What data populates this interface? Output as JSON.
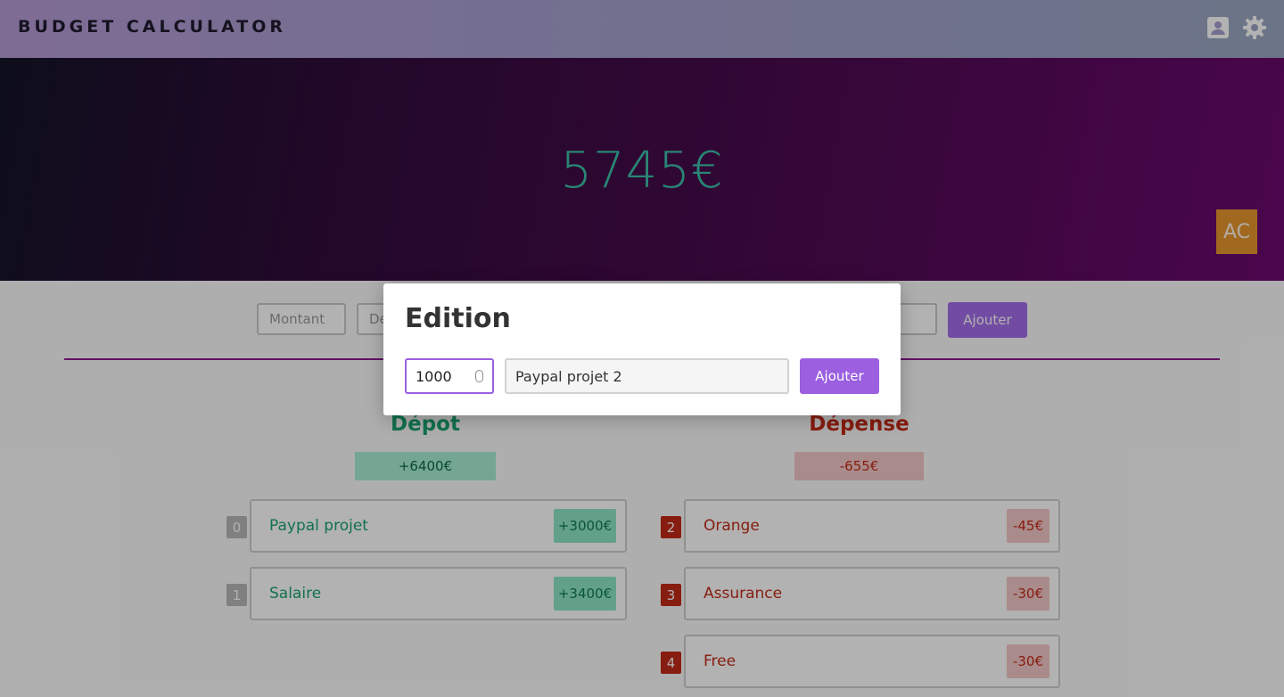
{
  "navbar": {
    "brand": "BUDGET CALCULATOR",
    "icons": [
      "user-card-icon",
      "gear-icon"
    ]
  },
  "hero": {
    "balance": "5745€",
    "avatar_initials": "AC"
  },
  "form": {
    "amount_placeholder": "Montant",
    "description_placeholder_visible": "De",
    "add_label": "Ajouter"
  },
  "deposits": {
    "title": "Dépot",
    "total": "+6400€",
    "items": [
      {
        "index": "0",
        "label": "Paypal projet",
        "amount": "+3000€"
      },
      {
        "index": "1",
        "label": "Salaire",
        "amount": "+3400€"
      }
    ]
  },
  "expenses": {
    "title": "Dépense",
    "total": "-655€",
    "items": [
      {
        "index": "2",
        "label": "Orange",
        "amount": "-45€"
      },
      {
        "index": "3",
        "label": "Assurance",
        "amount": "-30€"
      },
      {
        "index": "4",
        "label": "Free",
        "amount": "-30€"
      }
    ]
  },
  "modal": {
    "title": "Edition",
    "amount_value": "1000",
    "description_value": "Paypal projet 2",
    "add_label": "Ajouter"
  },
  "colors": {
    "accent": "#9b5fe0",
    "deposit_green": "#1aa36e",
    "expense_red": "#c22a17",
    "balance_teal": "#3bc0a8",
    "avatar_orange": "#e7972f"
  }
}
